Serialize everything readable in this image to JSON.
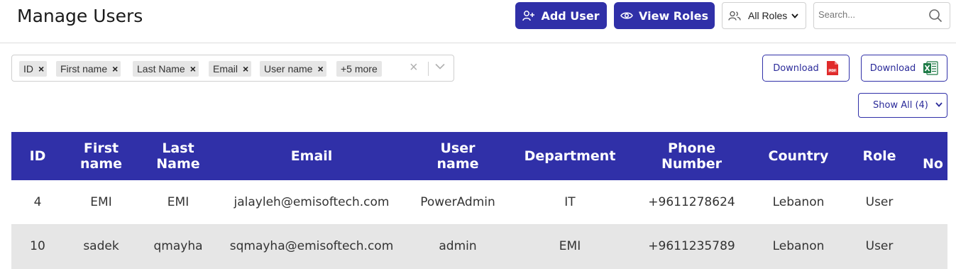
{
  "page": {
    "title": "Manage Users"
  },
  "toolbar": {
    "add_user_label": "Add User",
    "view_roles_label": "View Roles",
    "roles_filter_value": "All Roles",
    "search_placeholder": "Search..."
  },
  "column_filter": {
    "chips": [
      "ID",
      "First name",
      "Last Name",
      "Email",
      "User name"
    ],
    "more_label": "+5 more"
  },
  "downloads": {
    "pdf_label": "Download",
    "excel_label": "Download"
  },
  "show_select": {
    "value": "Show All (4)"
  },
  "table": {
    "headers": [
      "ID",
      "First name",
      "Last Name",
      "Email",
      "User name",
      "Department",
      "Phone Number",
      "Country",
      "Role",
      "No"
    ],
    "rows": [
      [
        "4",
        "EMI",
        "EMI",
        "jalayleh@emisoftech.com",
        "PowerAdmin",
        "IT",
        "+9611278624",
        "Lebanon",
        "User",
        ""
      ],
      [
        "10",
        "sadek",
        "qmayha",
        "sqmayha@emisoftech.com",
        "admin",
        "EMI",
        "+9611235789",
        "Lebanon",
        "User",
        ""
      ]
    ]
  },
  "colors": {
    "accent": "#3030a8",
    "row_alt": "#e6e6e6",
    "pdf_red": "#e02b2b",
    "excel_green": "#1d7a45"
  }
}
